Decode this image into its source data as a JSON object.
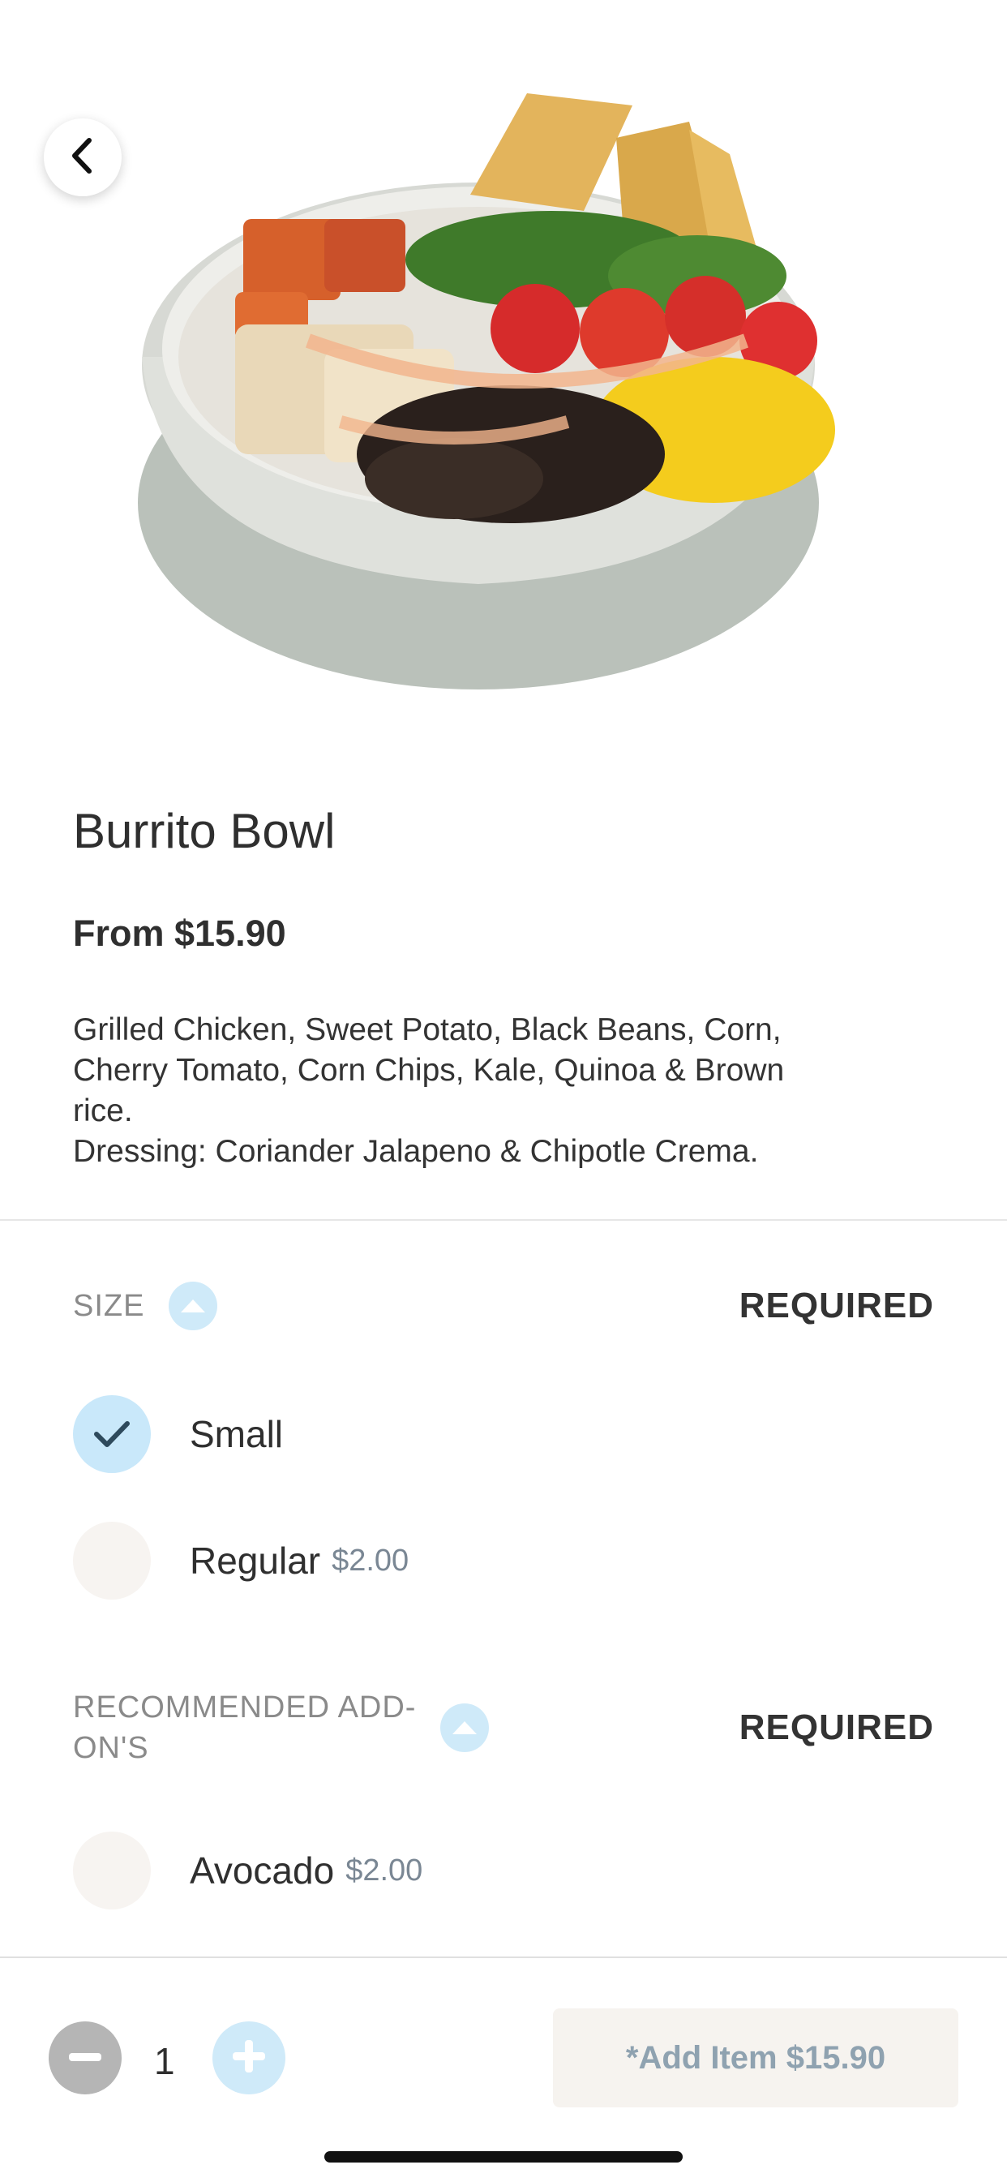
{
  "header": {
    "back_icon": "chevron-left-icon"
  },
  "product": {
    "image_alt": "Burrito Bowl",
    "title": "Burrito Bowl",
    "price": "From $15.90",
    "description_lines": [
      "Grilled Chicken, Sweet Potato, Black Beans, Corn,",
      "Cherry Tomato, Corn Chips, Kale, Quinoa & Brown",
      "rice.",
      "Dressing: Coriander Jalapeno & Chipotle Crema."
    ]
  },
  "size": {
    "title": "SIZE",
    "required": "REQUIRED",
    "options": [
      {
        "label": "Small",
        "price": "",
        "selected": true
      },
      {
        "label": "Regular",
        "price": "$2.00",
        "selected": false
      }
    ]
  },
  "addons": {
    "title_line1": "RECOMMENDED ADD-",
    "title_line2": "ON'S",
    "required": "REQUIRED",
    "options": [
      {
        "label": "Avocado",
        "price": "$2.00",
        "selected": false
      }
    ]
  },
  "footer": {
    "quantity": "1",
    "add_button": "*Add Item $15.90"
  },
  "colors": {
    "accent_light_blue": "#cfeaf9",
    "check_dark": "#2e4a5c",
    "add_button_bg": "#f6f3ef",
    "add_button_text": "#8fa2b0"
  }
}
